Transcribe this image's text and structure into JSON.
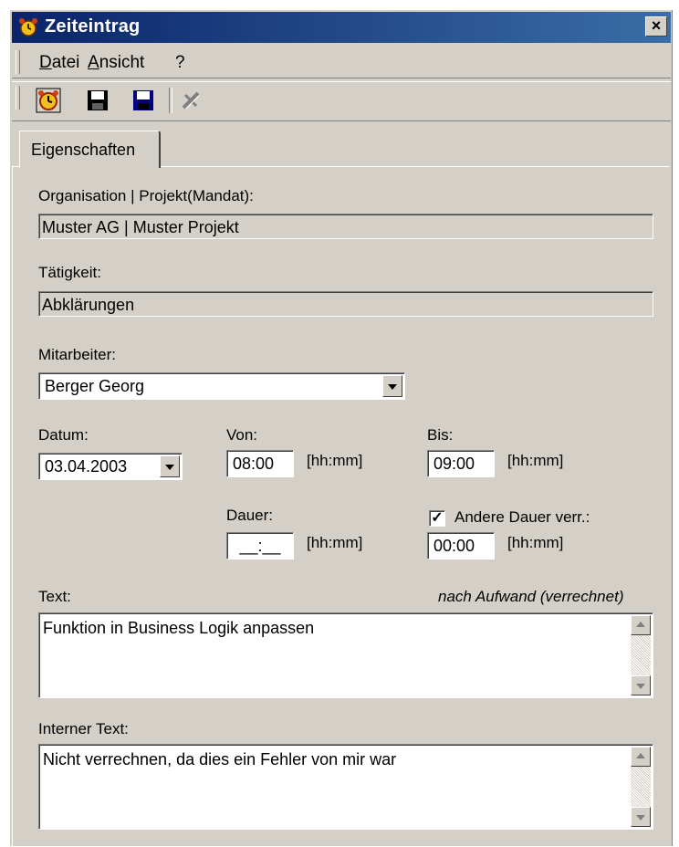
{
  "window": {
    "title": "Zeiteintrag",
    "close_label": "×"
  },
  "menu": {
    "datei": {
      "mnemonic": "D",
      "rest": "atei"
    },
    "ansicht": {
      "mnemonic": "A",
      "rest": "nsicht"
    },
    "help": "?"
  },
  "toolbar": {
    "icons": [
      "alarm-clock-icon",
      "save-icon",
      "save-as-icon",
      "delete-icon"
    ]
  },
  "tabs": [
    {
      "label": "Eigenschaften"
    }
  ],
  "form": {
    "org_label": "Organisation | Projekt(Mandat):",
    "org_value": "Muster AG | Muster Projekt",
    "activity_label": "Tätigkeit:",
    "activity_value": "Abklärungen",
    "employee_label": "Mitarbeiter:",
    "employee_value": "Berger Georg",
    "date_label": "Datum:",
    "date_value": "03.04.2003",
    "from_label": "Von:",
    "from_value": "08:00",
    "from_unit": "[hh:mm]",
    "to_label": "Bis:",
    "to_value": "09:00",
    "to_unit": "[hh:mm]",
    "duration_label": "Dauer:",
    "duration_value": "__:__",
    "duration_unit": "[hh:mm]",
    "other_duration_label": "Andere Dauer verr.:",
    "other_duration_checked": "✓",
    "other_duration_value": "00:00",
    "other_duration_unit": "[hh:mm]",
    "text_label": "Text:",
    "billing_note": "nach Aufwand (verrechnet)",
    "text_value": "Funktion in Business Logik anpassen",
    "internal_label": "Interner Text:",
    "internal_value": "Nicht verrechnen, da dies ein Fehler von mir war"
  }
}
